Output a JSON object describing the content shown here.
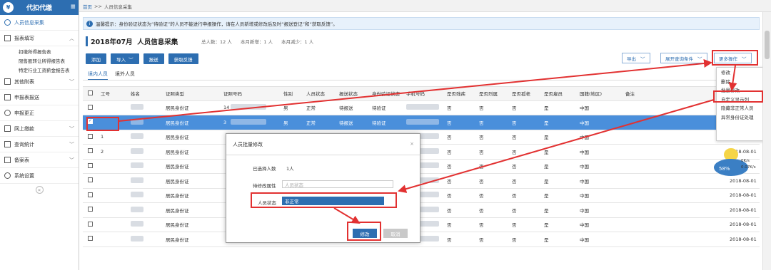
{
  "app": {
    "title": "代扣代缴"
  },
  "sidebar": {
    "items": [
      {
        "label": "人员信息采集",
        "icon": "user-icon",
        "active": true
      },
      {
        "label": "报表填写",
        "icon": "edit-icon",
        "expanded": true
      },
      {
        "label": "其他附表",
        "icon": "grid-icon"
      },
      {
        "label": "申报表报送",
        "icon": "send-icon"
      },
      {
        "label": "申报更正",
        "icon": "search-icon"
      },
      {
        "label": "网上缴款",
        "icon": "wallet-icon"
      },
      {
        "label": "查询统计",
        "icon": "query-icon"
      },
      {
        "label": "备案表",
        "icon": "file-icon"
      },
      {
        "label": "系统设置",
        "icon": "gear-icon"
      }
    ],
    "subitems": [
      "扣缴所得报告表",
      "限售股转让所得报告表",
      "特定行业工资薪金报告表"
    ],
    "collapse_icon": "«"
  },
  "breadcrumb": {
    "home": "首页",
    "sep": ">>",
    "current": "人员信息采集"
  },
  "notice": "温馨提示：身份验证状态为“待验证”的人员不能进行申报操作，请在人员新增或修改后及时“报送登记”和“获取反馈”。",
  "period": "2018年07月",
  "page_title": "人员信息采集",
  "stats": {
    "total": "总人数：12 人",
    "added": "本月新增：1 人",
    "reduced": "本月减少：1 人"
  },
  "toolbar": {
    "add": "添加",
    "import": "导入",
    "submit": "报送",
    "feedback": "获取反馈",
    "export": "导出",
    "expand": "展开查询条件",
    "more": "更多操作"
  },
  "tabs": [
    "境内人员",
    "境外人员"
  ],
  "table": {
    "headers": [
      "工号",
      "姓名",
      "证照类型",
      "证照号码",
      "性别",
      "人员状态",
      "报送状态",
      "身份验证状态",
      "手机号码",
      "是否残疾",
      "是否烈属",
      "是否孤老",
      "是否雇员",
      "国籍(地区)",
      "备注"
    ],
    "rows": [
      {
        "no": "",
        "type": "居民身份证",
        "id": "14",
        "gender": "男",
        "status": "正常",
        "send": "待报送",
        "verify": "待验证",
        "d": "否",
        "l": "否",
        "g": "否",
        "e": "是",
        "nation": "中国",
        "date": "",
        "selected": false
      },
      {
        "no": "",
        "type": "居民身份证",
        "id": "3",
        "gender": "男",
        "status": "正常",
        "send": "待报送",
        "verify": "待验证",
        "d": "否",
        "l": "否",
        "g": "否",
        "e": "是",
        "nation": "中国",
        "date": "",
        "selected": true
      },
      {
        "no": "1",
        "type": "居民身份证",
        "id": "",
        "gender": "",
        "status": "",
        "send": "",
        "verify": "",
        "d": "否",
        "l": "否",
        "g": "否",
        "e": "是",
        "nation": "中国",
        "date": "",
        "selected": false
      },
      {
        "no": "2",
        "type": "居民身份证",
        "id": "",
        "gender": "",
        "status": "",
        "send": "",
        "verify": "",
        "d": "否",
        "l": "否",
        "g": "否",
        "e": "是",
        "nation": "中国",
        "date": "2018-08-01",
        "selected": false
      },
      {
        "no": "",
        "type": "居民身份证",
        "id": "",
        "gender": "",
        "status": "",
        "send": "",
        "verify": "",
        "d": "否",
        "l": "否",
        "g": "否",
        "e": "是",
        "nation": "中国",
        "date": "",
        "selected": false
      },
      {
        "no": "",
        "type": "居民身份证",
        "id": "",
        "gender": "",
        "status": "",
        "send": "",
        "verify": "",
        "d": "否",
        "l": "否",
        "g": "否",
        "e": "是",
        "nation": "中国",
        "date": "2018-08-01",
        "selected": false
      },
      {
        "no": "",
        "type": "居民身份证",
        "id": "",
        "gender": "",
        "status": "",
        "send": "",
        "verify": "",
        "d": "否",
        "l": "否",
        "g": "否",
        "e": "是",
        "nation": "中国",
        "date": "2018-08-01",
        "selected": false
      },
      {
        "no": "",
        "type": "居民身份证",
        "id": "",
        "gender": "",
        "status": "",
        "send": "",
        "verify": "",
        "d": "否",
        "l": "否",
        "g": "否",
        "e": "是",
        "nation": "中国",
        "date": "2018-08-01",
        "selected": false
      },
      {
        "no": "",
        "type": "居民身份证",
        "id": "",
        "gender": "",
        "status": "",
        "send": "",
        "verify": "",
        "d": "否",
        "l": "否",
        "g": "否",
        "e": "是",
        "nation": "中国",
        "date": "2018-08-01",
        "selected": false
      },
      {
        "no": "",
        "type": "居民身份证",
        "id": "",
        "gender": "",
        "status": "",
        "send": "",
        "verify": "",
        "d": "否",
        "l": "否",
        "g": "否",
        "e": "是",
        "nation": "中国",
        "date": "2018-08-01",
        "selected": false
      }
    ]
  },
  "modal": {
    "title": "人员批量修改",
    "selected_label": "已选择人数",
    "selected_value": "1人",
    "attr_label": "待修改属性",
    "attr_placeholder": "人员状态",
    "status_label": "人员状态",
    "status_value": "非正常",
    "ok": "修改",
    "cancel": "取消",
    "close": "×"
  },
  "dropdown": [
    "修改",
    "删除",
    "批量修改",
    "自定义显示列",
    "隐藏非正常人员",
    "异常身份证处理"
  ],
  "widget": {
    "percent": "58%",
    "speed": "0K/s",
    "speed2": "0.07K/s"
  },
  "colors": {
    "accent": "#2d6eb1",
    "highlight": "#e23131"
  }
}
